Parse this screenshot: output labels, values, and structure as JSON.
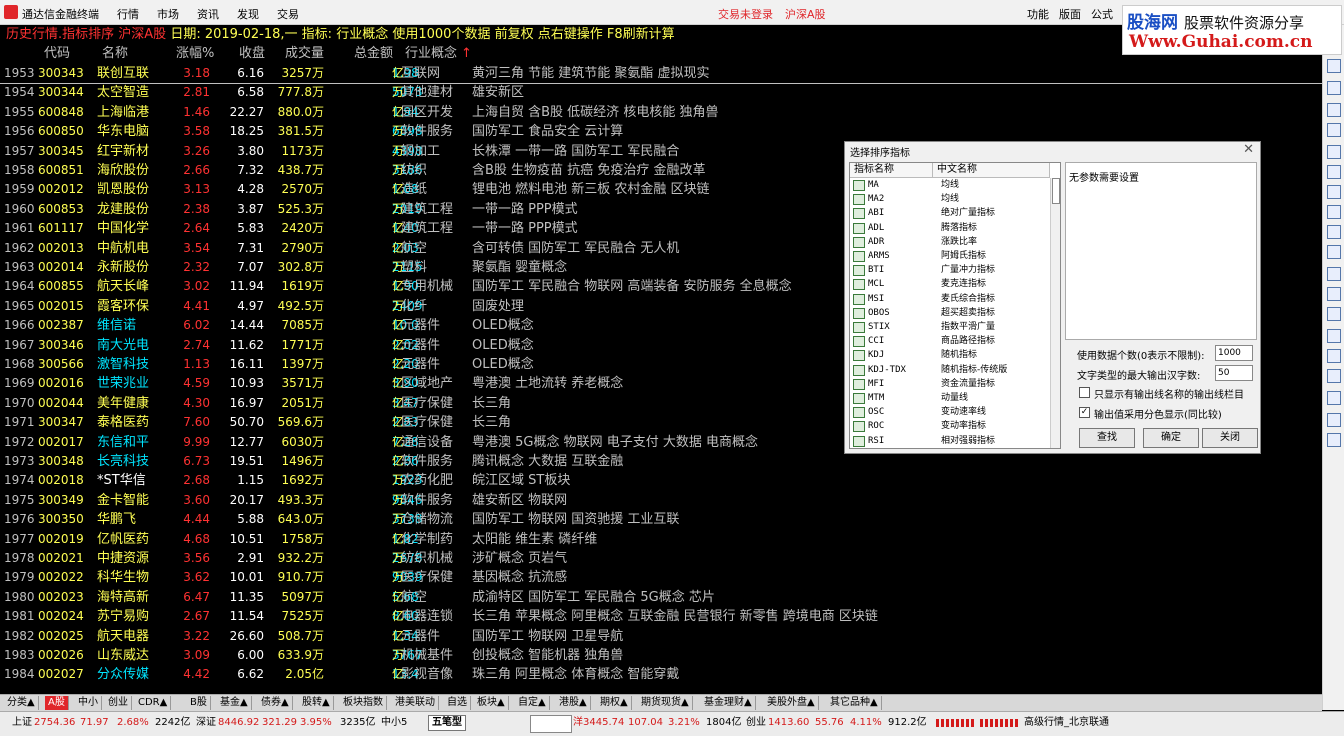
{
  "titlebar": {
    "app": "通达信金融终端",
    "menus": [
      "行情",
      "市场",
      "资讯",
      "发现",
      "交易"
    ],
    "login_status": "交易未登录",
    "market": "沪深A股",
    "right_menus": [
      "功能",
      "版面",
      "公式"
    ]
  },
  "watermark": {
    "brand": "股海网",
    "slogan": "股票软件资源分享",
    "url": "Www.Guhai.com.cn"
  },
  "infobar": {
    "mode": "历史行情.指标排序 沪深A股",
    "date_label": "日期:",
    "date": "2019-02-18,一",
    "indicator_label": "指标:",
    "indicator": "行业概念",
    "hint": "使用1000个数据 前复权 点右键操作 F8刷新计算"
  },
  "columns": {
    "code": "代码",
    "name": "名称",
    "pct": "涨幅%",
    "close": "收盘",
    "volume": "成交量",
    "amount": "总金额",
    "industry": "行业概念",
    "sort_arrow": "↑"
  },
  "rows": [
    {
      "idx": "1953",
      "code": "300343",
      "name": "联创互联",
      "pct": "3.18",
      "close": "6.16",
      "vol": "3257万",
      "amt": "1.98",
      "amt_u": "亿",
      "ind": "互联网",
      "con": "黄河三角 节能 建筑节能 聚氨酯 虚拟现实",
      "name_color": "yellow"
    },
    {
      "idx": "1954",
      "code": "300344",
      "name": "太空智造",
      "pct": "2.81",
      "close": "6.58",
      "vol": "777.8万",
      "amt": "5073",
      "amt_u": "万",
      "ind": "其他建材",
      "con": "雄安新区",
      "name_color": "yellow"
    },
    {
      "idx": "1955",
      "code": "600848",
      "name": "上海临港",
      "pct": "1.46",
      "close": "22.27",
      "vol": "880.0万",
      "amt": "1.94",
      "amt_u": "亿",
      "ind": "园区开发",
      "con": "上海自贸 含B股 低碳经济 核电核能 独角兽",
      "name_color": "yellow"
    },
    {
      "idx": "1956",
      "code": "600850",
      "name": "华东电脑",
      "pct": "3.58",
      "close": "18.25",
      "vol": "381.5万",
      "amt": "6898",
      "amt_u": "万",
      "ind": "软件服务",
      "con": "国防军工 食品安全 云计算",
      "name_color": "yellow"
    },
    {
      "idx": "1957",
      "code": "300345",
      "name": "红宇新材",
      "pct": "3.26",
      "close": "3.80",
      "vol": "1173万",
      "amt": "4398",
      "amt_u": "万",
      "ind": "钢加工",
      "con": "长株潭 一带一路 国防军工 军民融合",
      "name_color": "yellow"
    },
    {
      "idx": "1958",
      "code": "600851",
      "name": "海欣股份",
      "pct": "2.66",
      "close": "7.32",
      "vol": "438.7万",
      "amt": "3186",
      "amt_u": "万",
      "ind": "纺织",
      "con": "含B股 生物疫苗 抗癌 免疫治疗 金融改革",
      "name_color": "yellow"
    },
    {
      "idx": "1959",
      "code": "002012",
      "name": "凯恩股份",
      "pct": "3.13",
      "close": "4.28",
      "vol": "2570万",
      "amt": "1.08",
      "amt_u": "亿",
      "ind": "造纸",
      "con": "锂电池 燃料电池 新三板 农村金融 区块链",
      "name_color": "yellow"
    },
    {
      "idx": "1960",
      "code": "600853",
      "name": "龙建股份",
      "pct": "2.38",
      "close": "3.87",
      "vol": "525.3万",
      "amt": "2019",
      "amt_u": "万",
      "ind": "建筑工程",
      "con": "一带一路 PPP模式",
      "name_color": "yellow"
    },
    {
      "idx": "1961",
      "code": "601117",
      "name": "中国化学",
      "pct": "2.64",
      "close": "5.83",
      "vol": "2420万",
      "amt": "1.40",
      "amt_u": "亿",
      "ind": "建筑工程",
      "con": "一带一路 PPP模式",
      "name_color": "yellow"
    },
    {
      "idx": "1962",
      "code": "002013",
      "name": "中航机电",
      "pct": "3.54",
      "close": "7.31",
      "vol": "2790万",
      "amt": "2.03",
      "amt_u": "亿",
      "ind": "航空",
      "con": "含可转债 国防军工 军民融合 无人机",
      "name_color": "yellow"
    },
    {
      "idx": "1963",
      "code": "002014",
      "name": "永新股份",
      "pct": "2.32",
      "close": "7.07",
      "vol": "302.8万",
      "amt": "2115",
      "amt_u": "万",
      "ind": "塑料",
      "con": "聚氨酯 婴童概念",
      "name_color": "yellow"
    },
    {
      "idx": "1964",
      "code": "600855",
      "name": "航天长峰",
      "pct": "3.02",
      "close": "11.94",
      "vol": "1619万",
      "amt": "1.90",
      "amt_u": "亿",
      "ind": "专用机械",
      "con": "国防军工 军民融合 物联网 高端装备 安防服务 全息概念",
      "name_color": "yellow"
    },
    {
      "idx": "1965",
      "code": "002015",
      "name": "霞客环保",
      "pct": "4.41",
      "close": "4.97",
      "vol": "492.5万",
      "amt": "2409",
      "amt_u": "万",
      "ind": "化纤",
      "con": "固废处理",
      "name_color": "yellow"
    },
    {
      "idx": "1966",
      "code": "002387",
      "name": "维信诺",
      "pct": "6.02",
      "close": "14.44",
      "vol": "7085万",
      "amt": "10.0",
      "amt_u": "亿",
      "ind": "元器件",
      "con": "OLED概念",
      "name_color": "cyan"
    },
    {
      "idx": "1967",
      "code": "300346",
      "name": "南大光电",
      "pct": "2.74",
      "close": "11.62",
      "vol": "1771万",
      "amt": "2.02",
      "amt_u": "亿",
      "ind": "元器件",
      "con": "OLED概念",
      "name_color": "cyan"
    },
    {
      "idx": "1968",
      "code": "300566",
      "name": "激智科技",
      "pct": "1.13",
      "close": "16.11",
      "vol": "1397万",
      "amt": "2.20",
      "amt_u": "亿",
      "ind": "元器件",
      "con": "OLED概念",
      "name_color": "cyan"
    },
    {
      "idx": "1969",
      "code": "002016",
      "name": "世荣兆业",
      "pct": "4.59",
      "close": "10.93",
      "vol": "3571万",
      "amt": "3.90",
      "amt_u": "亿",
      "ind": "区域地产",
      "con": "粤港澳 土地流转 养老概念",
      "name_color": "cyan"
    },
    {
      "idx": "1970",
      "code": "002044",
      "name": "美年健康",
      "pct": "4.30",
      "close": "16.97",
      "vol": "2051万",
      "amt": "3.47",
      "amt_u": "亿",
      "ind": "医疗保健",
      "con": "长三角",
      "name_color": "yellow"
    },
    {
      "idx": "1971",
      "code": "300347",
      "name": "泰格医药",
      "pct": "7.60",
      "close": "50.70",
      "vol": "569.6万",
      "amt": "2.83",
      "amt_u": "亿",
      "ind": "医疗保健",
      "con": "长三角",
      "name_color": "yellow"
    },
    {
      "idx": "1972",
      "code": "002017",
      "name": "东信和平",
      "pct": "9.99",
      "close": "12.77",
      "vol": "6030万",
      "amt": "7.28",
      "amt_u": "亿",
      "ind": "通信设备",
      "con": "粤港澳 5G概念 物联网 电子支付 大数据 电商概念",
      "name_color": "cyan"
    },
    {
      "idx": "1973",
      "code": "300348",
      "name": "长亮科技",
      "pct": "6.73",
      "close": "19.51",
      "vol": "1496万",
      "amt": "2.86",
      "amt_u": "亿",
      "ind": "软件服务",
      "con": "腾讯概念 大数据 互联金融",
      "name_color": "cyan"
    },
    {
      "idx": "1974",
      "code": "002018",
      "name": "*ST华信",
      "pct": "2.68",
      "close": "1.15",
      "vol": "1692万",
      "amt": "1923",
      "amt_u": "万",
      "ind": "农药化肥",
      "con": "皖江区域 ST板块",
      "name_color": "white"
    },
    {
      "idx": "1975",
      "code": "300349",
      "name": "金卡智能",
      "pct": "3.60",
      "close": "20.17",
      "vol": "493.3万",
      "amt": "9846",
      "amt_u": "万",
      "ind": "软件服务",
      "con": "雄安新区 物联网",
      "name_color": "yellow"
    },
    {
      "idx": "1976",
      "code": "300350",
      "name": "华鹏飞",
      "pct": "4.44",
      "close": "5.88",
      "vol": "643.0万",
      "amt": "3738",
      "amt_u": "万",
      "ind": "仓储物流",
      "con": "国防军工 物联网 国资驰援 工业互联",
      "name_color": "yellow"
    },
    {
      "idx": "1977",
      "code": "002019",
      "name": "亿帆医药",
      "pct": "4.68",
      "close": "10.51",
      "vol": "1758万",
      "amt": "1.82",
      "amt_u": "亿",
      "ind": "化学制药",
      "con": "太阳能 维生素 磷纤维",
      "name_color": "yellow"
    },
    {
      "idx": "1978",
      "code": "002021",
      "name": "中捷资源",
      "pct": "3.56",
      "close": "2.91",
      "vol": "932.2万",
      "amt": "2678",
      "amt_u": "万",
      "ind": "纺织机械",
      "con": "涉矿概念 页岩气",
      "name_color": "yellow"
    },
    {
      "idx": "1979",
      "code": "002022",
      "name": "科华生物",
      "pct": "3.62",
      "close": "10.01",
      "vol": "910.7万",
      "amt": "9039",
      "amt_u": "万",
      "ind": "医疗保健",
      "con": "基因概念 抗流感",
      "name_color": "yellow"
    },
    {
      "idx": "1980",
      "code": "002023",
      "name": "海特高新",
      "pct": "6.47",
      "close": "11.35",
      "vol": "5097万",
      "amt": "5.68",
      "amt_u": "亿",
      "ind": "航空",
      "con": "成渝特区 国防军工 军民融合 5G概念 芯片",
      "name_color": "yellow"
    },
    {
      "idx": "1981",
      "code": "002024",
      "name": "苏宁易购",
      "pct": "2.67",
      "close": "11.54",
      "vol": "7525万",
      "amt": "8.60",
      "amt_u": "亿",
      "ind": "电器连锁",
      "con": "长三角 苹果概念 阿里概念 互联金融 民营银行 新零售 跨境电商 区块链",
      "name_color": "yellow"
    },
    {
      "idx": "1982",
      "code": "002025",
      "name": "航天电器",
      "pct": "3.22",
      "close": "26.60",
      "vol": "508.7万",
      "amt": "1.34",
      "amt_u": "亿",
      "ind": "元器件",
      "con": "国防军工 物联网 卫星导航",
      "name_color": "yellow"
    },
    {
      "idx": "1983",
      "code": "002026",
      "name": "山东威达",
      "pct": "3.09",
      "close": "6.00",
      "vol": "633.9万",
      "amt": "3767",
      "amt_u": "万",
      "ind": "机械基件",
      "con": "创投概念 智能机器 独角兽",
      "name_color": "yellow"
    },
    {
      "idx": "1984",
      "code": "002027",
      "name": "分众传媒",
      "pct": "4.42",
      "close": "6.62",
      "vol": "2.05亿",
      "amt": "13.4",
      "amt_u": "亿",
      "ind": "影视音像",
      "con": "珠三角 阿里概念 体育概念 智能穿戴",
      "name_color": "cyan"
    }
  ],
  "dialog": {
    "title": "选择排序指标",
    "col_name": "指标名称",
    "col_cn": "中文名称",
    "items": [
      {
        "abbr": "MA",
        "cn": "均线"
      },
      {
        "abbr": "MA2",
        "cn": "均线"
      },
      {
        "abbr": "ABI",
        "cn": "绝对广量指标"
      },
      {
        "abbr": "ADL",
        "cn": "腾落指标"
      },
      {
        "abbr": "ADR",
        "cn": "涨跌比率"
      },
      {
        "abbr": "ARMS",
        "cn": "阿姆氏指标"
      },
      {
        "abbr": "BTI",
        "cn": "广量冲力指标"
      },
      {
        "abbr": "MCL",
        "cn": "麦克连指标"
      },
      {
        "abbr": "MSI",
        "cn": "麦氏综合指标"
      },
      {
        "abbr": "OBOS",
        "cn": "超买超卖指标"
      },
      {
        "abbr": "STIX",
        "cn": "指数平滑广量"
      },
      {
        "abbr": "CCI",
        "cn": "商品路径指标"
      },
      {
        "abbr": "KDJ",
        "cn": "随机指标"
      },
      {
        "abbr": "KDJ-TDX",
        "cn": "随机指标-传统版"
      },
      {
        "abbr": "MFI",
        "cn": "资金流量指标"
      },
      {
        "abbr": "MTM",
        "cn": "动量线"
      },
      {
        "abbr": "OSC",
        "cn": "变动速率线"
      },
      {
        "abbr": "ROC",
        "cn": "变动率指标"
      },
      {
        "abbr": "RSI",
        "cn": "相对强弱指标"
      }
    ],
    "note": "无参数需要设置",
    "data_count_label": "使用数据个数(0表示不限制):",
    "data_count": "1000",
    "max_chars_label": "文字类型的最大输出汉字数:",
    "max_chars": "50",
    "only_show_label": "只显示有输出线名称的输出线栏目",
    "only_show_checked": "",
    "color_label": "输出值采用分色显示(同比较)",
    "color_checked": "✓",
    "find_btn": "查找",
    "ok_btn": "确定",
    "close_btn": "关闭"
  },
  "tabs": [
    "分类▲",
    "A股",
    "中小",
    "创业",
    "CDR▲",
    "B股",
    "基金▲",
    "债券▲",
    "股转▲",
    "板块指数",
    "港美联动",
    "自选",
    "板块▲",
    "自定▲",
    "港股▲",
    "期权▲",
    "期货现货▲",
    "基金理财▲",
    "美股外盘▲",
    "其它品种▲"
  ],
  "status": {
    "sh_label": "上证",
    "sh_index": "2754.36",
    "sh_chg": "71.97",
    "sh_pct": "2.68%",
    "sh_amt": "2242亿",
    "sz_label": "深证",
    "sz_index": "8446.92",
    "sz_chg": "321.29",
    "sz_pct": "3.95%",
    "sz_amt": "3235亿",
    "zx_label": "中小5",
    "input_label": "五笔型",
    "mid_value": "洋3445.74",
    "mid_chg": "107.04",
    "mid_pct": "3.21%",
    "mid_amt": "1804亿",
    "cy_label": "创业",
    "cy_index": "1413.60",
    "cy_chg": "55.76",
    "cy_pct": "4.11%",
    "cy_amt": "912.2亿",
    "right_text": "高级行情_北京联通"
  }
}
